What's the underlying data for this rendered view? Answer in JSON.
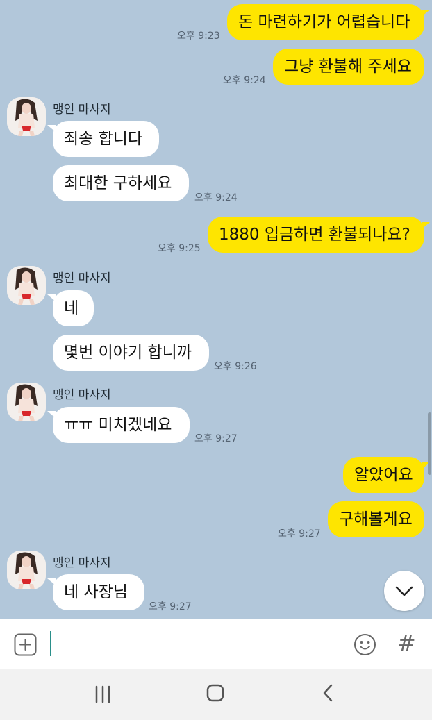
{
  "chat": {
    "sender_name": "맹인 마사지",
    "messages": [
      {
        "text": "돈 마련하기가 어렵습니다",
        "time": "오후 9:23"
      },
      {
        "text": "그냥 환불해 주세요",
        "time": "오후 9:24"
      },
      {
        "text": "죄송 합니다"
      },
      {
        "text": "최대한 구하세요",
        "time": "오후 9:24"
      },
      {
        "text": "1880  입금하면 환불되나요?",
        "time": "오후 9:25"
      },
      {
        "text": "네"
      },
      {
        "text": "몇번 이야기 합니까",
        "time": "오후 9:26"
      },
      {
        "text": "ㅠㅠ 미치겠네요",
        "time": "오후 9:27"
      },
      {
        "text": "알았어요"
      },
      {
        "text": "구해볼게요",
        "time": "오후 9:27"
      },
      {
        "text": "네 사장님",
        "time": "오후 9:27"
      }
    ]
  },
  "input": {
    "attach_icon": "plus-square-icon",
    "emoji_icon": "smiley-icon",
    "hashtag_label": "#"
  },
  "navbar": {
    "recent_icon": "recent-apps-icon",
    "home_icon": "home-icon",
    "back_icon": "back-icon"
  }
}
